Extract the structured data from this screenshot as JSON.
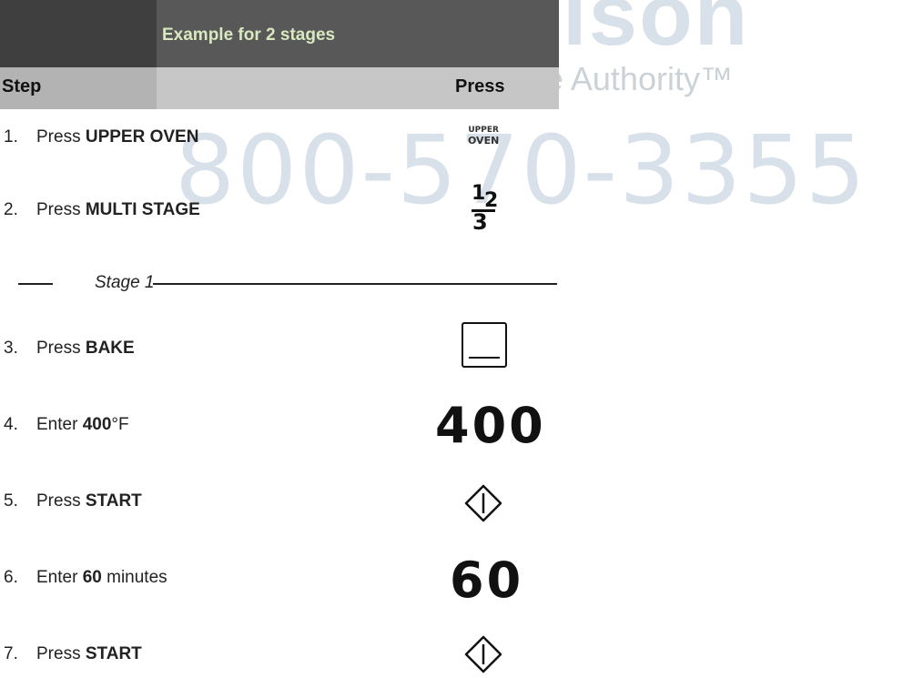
{
  "watermark": {
    "brand": "Madison",
    "tagline": "Your Appliance Authority™",
    "phone": "800-570-3355"
  },
  "table": {
    "title": "Example for 2 stages",
    "col_step": "Step",
    "col_press": "Press"
  },
  "steps": [
    {
      "num": "1.",
      "pre": "Press ",
      "bold": "UPPER OVEN",
      "post": ""
    },
    {
      "num": "2.",
      "pre": "Press ",
      "bold": "MULTI STAGE",
      "post": ""
    },
    {
      "num": "3.",
      "pre": "Press ",
      "bold": "BAKE",
      "post": ""
    },
    {
      "num": "4.",
      "pre": "Enter ",
      "bold": "400",
      "post": "°F"
    },
    {
      "num": "5.",
      "pre": "Press ",
      "bold": "START",
      "post": ""
    },
    {
      "num": "6.",
      "pre": "Enter ",
      "bold": "60",
      "post": " minutes"
    },
    {
      "num": "7.",
      "pre": "Press ",
      "bold": "START",
      "post": ""
    }
  ],
  "stage_label": "Stage 1",
  "icons": {
    "upper_oven_line1": "UPPER",
    "upper_oven_line2": "OVEN",
    "multi_stage_digits": [
      "1",
      "2",
      "3"
    ],
    "temp_value": "400",
    "time_value": "60",
    "names": [
      "upper-oven-key-icon",
      "multi-stage-icon",
      "bake-icon",
      "start-icon"
    ]
  }
}
